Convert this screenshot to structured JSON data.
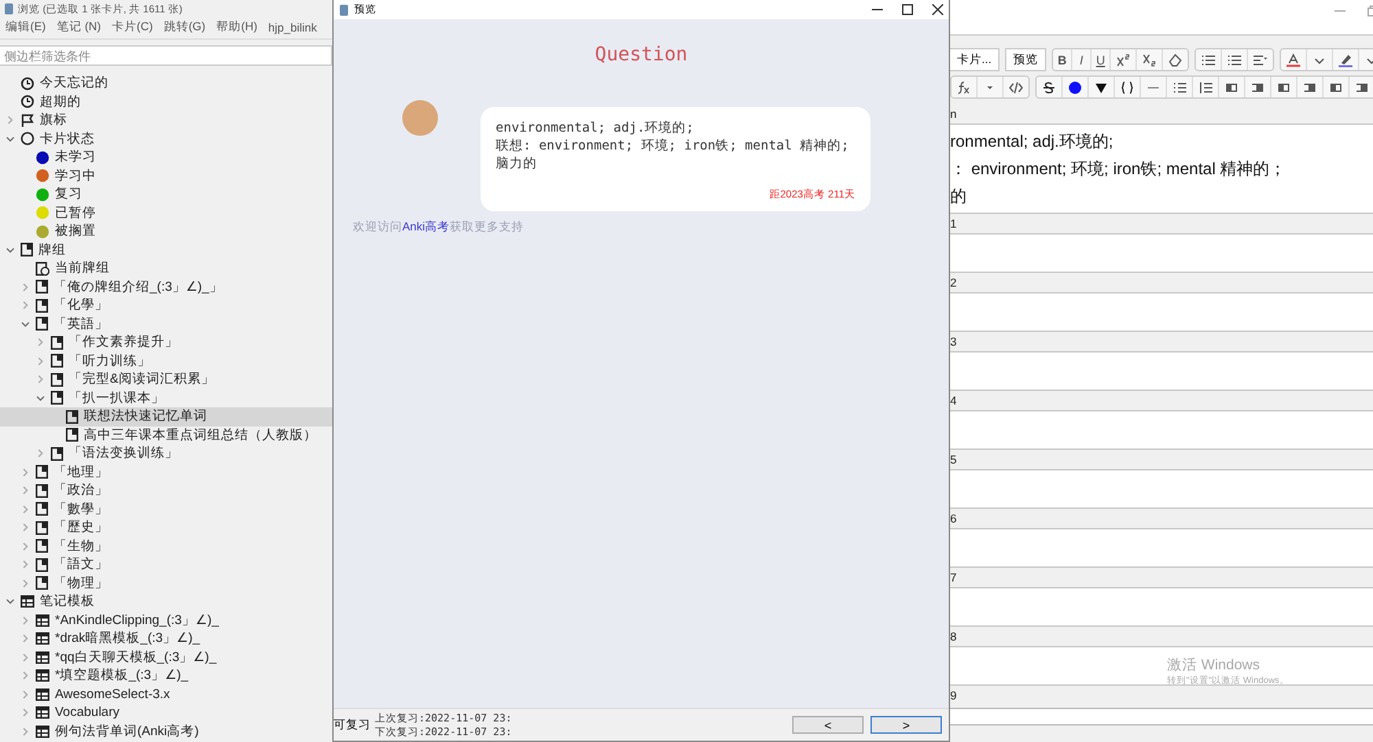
{
  "browser_window": {
    "title": "浏览 (已选取 1 张卡片, 共 1611 张)",
    "menu": [
      "编辑(E)",
      "笔记 (N)",
      "卡片(C)",
      "跳转(G)",
      "帮助(H)",
      "hjp_bilink"
    ],
    "filter": {
      "placeholder": "侧边栏筛选条件"
    },
    "tree": [
      {
        "children": [
          {
            "label": "今天忘记的",
            "kind": "clock",
            "selected": false
          },
          {
            "label": "超期的",
            "kind": "clock",
            "selected": false
          }
        ]
      },
      {
        "label": "旗标",
        "kind": "flag",
        "expanded": false,
        "selected": false
      },
      {
        "label": "卡片状态",
        "kind": "circle",
        "expanded": true,
        "selected": false,
        "children": [
          {
            "label": "未学习",
            "kind": "dot",
            "color": "#0a0ab4",
            "selected": false
          },
          {
            "label": "学习中",
            "kind": "dot",
            "color": "#d2601e",
            "selected": false
          },
          {
            "label": "复习",
            "kind": "dot",
            "color": "#10b010",
            "selected": false
          },
          {
            "label": "已暂停",
            "kind": "dot",
            "color": "#dcdc00",
            "selected": false
          },
          {
            "label": "被搁置",
            "kind": "dot",
            "color": "#aaaa30",
            "selected": false
          }
        ]
      },
      {
        "label": "牌组",
        "kind": "deck",
        "expanded": true,
        "selected": false,
        "children": [
          {
            "label": "当前牌组",
            "kind": "current",
            "selected": false
          },
          {
            "label": "「俺の牌组介绍_(:3」∠)_」",
            "kind": "deck",
            "expanded": false,
            "selected": false
          },
          {
            "label": "「化學」",
            "kind": "deck",
            "expanded": false,
            "selected": false
          },
          {
            "label": "「英語」",
            "kind": "deck",
            "expanded": true,
            "selected": false,
            "children": [
              {
                "label": "「作文素养提升」",
                "kind": "deck",
                "expanded": false,
                "selected": false
              },
              {
                "label": "「听力训练」",
                "kind": "deck",
                "expanded": false,
                "selected": false
              },
              {
                "label": "「完型&阅读词汇积累」",
                "kind": "deck",
                "expanded": false,
                "selected": false
              },
              {
                "label": "「扒一扒课本」",
                "kind": "deck",
                "expanded": true,
                "selected": false,
                "children": [
                  {
                    "label": "联想法快速记忆单词",
                    "kind": "deck",
                    "selected": true
                  },
                  {
                    "label": "高中三年课本重点词组总结（人教版）",
                    "kind": "deck",
                    "selected": false
                  }
                ]
              },
              {
                "label": "「语法变换训练」",
                "kind": "deck",
                "expanded": false,
                "selected": false
              }
            ]
          },
          {
            "label": "「地理」",
            "kind": "deck",
            "expanded": false,
            "selected": false
          },
          {
            "label": "「政治」",
            "kind": "deck",
            "expanded": false,
            "selected": false
          },
          {
            "label": "「數學」",
            "kind": "deck",
            "expanded": false,
            "selected": false
          },
          {
            "label": "「歷史」",
            "kind": "deck",
            "expanded": false,
            "selected": false
          },
          {
            "label": "「生物」",
            "kind": "deck",
            "expanded": false,
            "selected": false
          },
          {
            "label": "「語文」",
            "kind": "deck",
            "expanded": false,
            "selected": false
          },
          {
            "label": "「物理」",
            "kind": "deck",
            "expanded": false,
            "selected": false
          }
        ]
      },
      {
        "label": "笔记模板",
        "kind": "notetype",
        "expanded": true,
        "selected": false,
        "children": [
          {
            "label": "*AnKindleClipping_(:3」∠)_",
            "kind": "notetype",
            "expanded": false,
            "selected": false
          },
          {
            "label": "*drak暗黑模板_(:3」∠)_",
            "kind": "notetype",
            "expanded": false,
            "selected": false
          },
          {
            "label": "*qq白天聊天模板_(:3」∠)_",
            "kind": "notetype",
            "expanded": false,
            "selected": false
          },
          {
            "label": "*填空题模板_(:3」∠)_",
            "kind": "notetype",
            "expanded": false,
            "selected": false
          },
          {
            "label": "AwesomeSelect-3.x",
            "kind": "notetype",
            "expanded": false,
            "selected": false
          },
          {
            "label": "Vocabulary",
            "kind": "notetype",
            "expanded": false,
            "selected": false
          },
          {
            "label": "例句法背单词(Anki高考)",
            "kind": "notetype",
            "expanded": false,
            "selected": false
          }
        ]
      }
    ]
  },
  "preview_window": {
    "title": "预览",
    "heading": "Question",
    "bubble": {
      "lines": [
        "environmental; adj.环境的;",
        "联想: environment; 环境; iron铁; mental 精神的; 脑力的"
      ],
      "countdown": "距2023高考 211天"
    },
    "promo": {
      "before": "欢迎访问",
      "link": "Anki高考",
      "after": "获取更多支持"
    },
    "status": {
      "label": "可复习",
      "last_review": "上次复习:2022-11-07 23:",
      "next_review": "下次复习:2022-11-07 23:"
    },
    "buttons": [
      "<",
      ">"
    ]
  },
  "editor": {
    "buttons": [
      "卡片...",
      "预览"
    ],
    "format_buttons": [
      "B",
      "I",
      "U"
    ],
    "fields": [
      {
        "label": "n",
        "lines": [
          "ronmental; adj.环境的;",
          "： environment; 环境; iron铁; mental 精神的；",
          "的"
        ]
      },
      {
        "label": "1"
      },
      {
        "label": "2"
      },
      {
        "label": "3"
      },
      {
        "label": "4"
      },
      {
        "label": "5"
      },
      {
        "label": "6"
      },
      {
        "label": "7"
      },
      {
        "label": "8"
      },
      {
        "label": "9"
      }
    ]
  },
  "os_notice": [
    "激活 Windows",
    "转到\"设置\"以激活 Windows。"
  ]
}
